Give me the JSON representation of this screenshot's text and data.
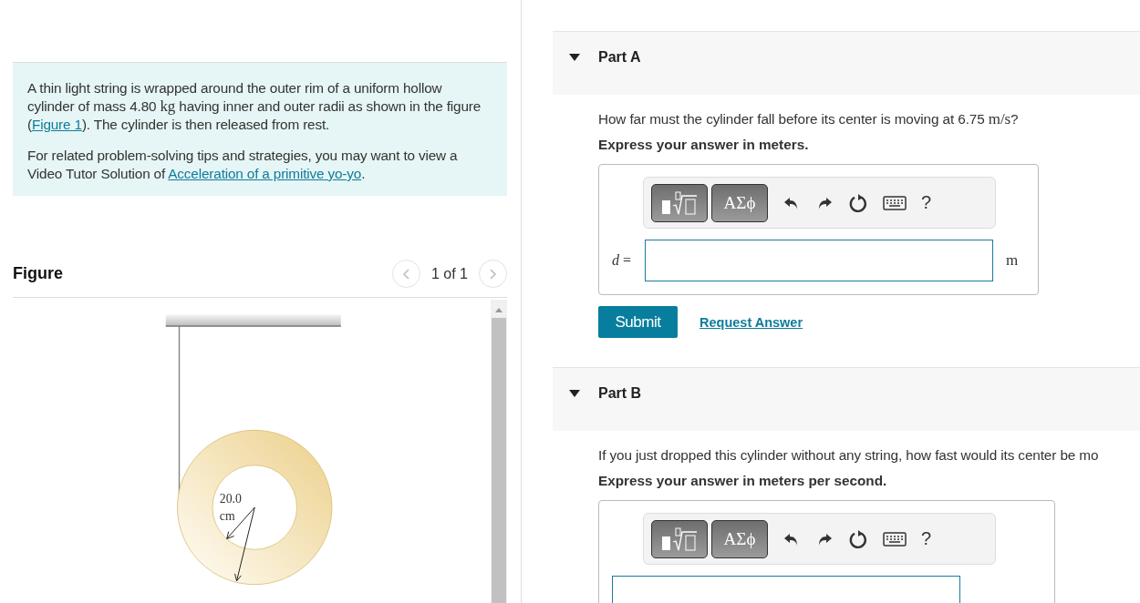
{
  "intro": {
    "paragraphs": [
      [
        {
          "kind": "text",
          "text": "A thin light string is wrapped around the outer rim of a uniform hollow cylinder of mass 4.80 "
        },
        {
          "kind": "math",
          "text": "kg"
        },
        {
          "kind": "text",
          "text": " having inner and outer radii as shown in the figure ("
        },
        {
          "kind": "link",
          "text": "Figure 1"
        },
        {
          "kind": "text",
          "text": "). The cylinder is then released from rest."
        }
      ],
      [
        {
          "kind": "text",
          "text": "For related problem-solving tips and strategies, you may want to view a Video Tutor Solution of "
        },
        {
          "kind": "link",
          "text": "Acceleration of a primitive yo-yo"
        },
        {
          "kind": "text",
          "text": "."
        }
      ]
    ]
  },
  "figure": {
    "title": "Figure",
    "pager": "1 of 1",
    "labels": [
      "20.0",
      "cm"
    ]
  },
  "parts": [
    {
      "title": "Part A",
      "expanded": true,
      "question": [
        {
          "kind": "text",
          "text": "How far must the cylinder fall before its center is moving at 6.75 "
        },
        {
          "kind": "math",
          "text": "m/s"
        },
        {
          "kind": "text",
          "text": "?"
        }
      ],
      "instruction": "Express your answer in meters.",
      "toolbar": {
        "greek": "ΑΣϕ",
        "help": "?"
      },
      "variable": "d",
      "equals": "=",
      "unit": "m",
      "submit": "Submit",
      "request": "Request Answer"
    },
    {
      "title": "Part B",
      "expanded": true,
      "question": [
        {
          "kind": "text",
          "text": "If you just dropped this cylinder without any string, how fast would its center be mo"
        }
      ],
      "instruction": "Express your answer in meters per second.",
      "toolbar": {
        "greek": "ΑΣϕ",
        "help": "?"
      }
    }
  ]
}
